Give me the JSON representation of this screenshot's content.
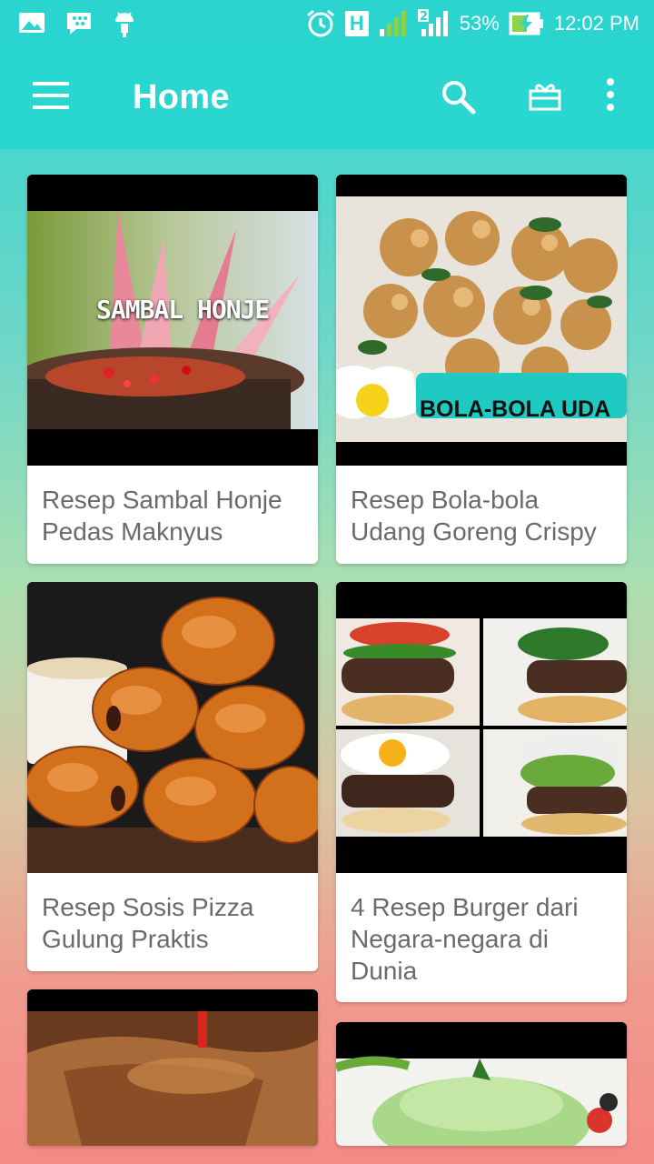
{
  "status_bar": {
    "battery": "53%",
    "time": "12:02 PM",
    "network": "H",
    "sim2": "2"
  },
  "app_bar": {
    "title": "Home"
  },
  "recipes": [
    {
      "title": "Resep Sambal Honje Pedas Maknyus",
      "image_text": "SAMBAL HONJE"
    },
    {
      "title": "Resep Bola-bola Udang Goreng Crispy",
      "image_text": "BOLA-BOLA UDA"
    },
    {
      "title": "Resep Sosis Pizza Gulung Praktis"
    },
    {
      "title": "4 Resep Burger dari Negara-negara di Dunia"
    }
  ]
}
